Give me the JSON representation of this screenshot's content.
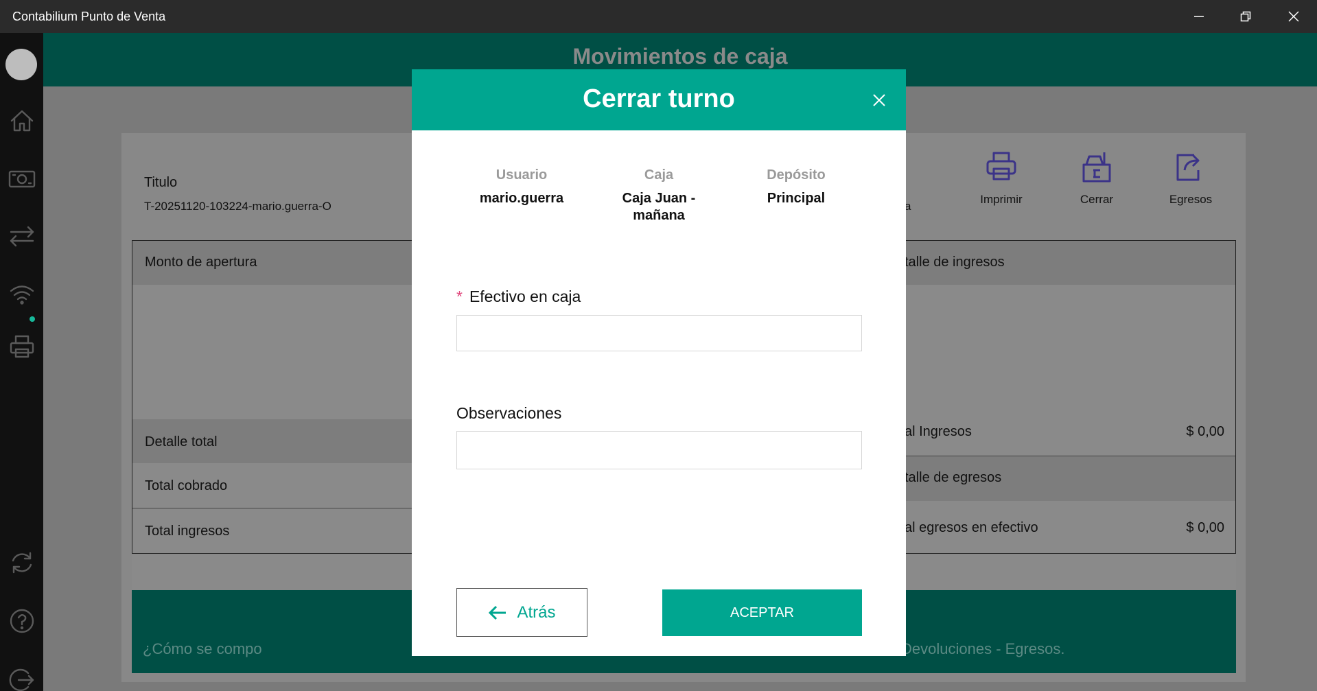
{
  "window": {
    "title": "Contabilium Punto de Venta"
  },
  "page": {
    "title": "Movimientos de caja"
  },
  "shift": {
    "title_label": "Titulo",
    "title_value": "T-20251120-103224-mario.guerra-O"
  },
  "toolbar": {
    "partial_label": "a",
    "print_label": "Imprimir",
    "close_label": "Cerrar",
    "expenses_label": "Egresos"
  },
  "left_panel": {
    "opening_amount": "Monto de apertura",
    "detail_total": "Detalle total",
    "total_collected": "Total cobrado",
    "total_income": "Total ingresos"
  },
  "right_panel": {
    "income_detail": "talle de ingresos",
    "income_total_label": "al Ingresos",
    "income_total_value": "$ 0,00",
    "expense_detail": "talle de egresos",
    "cash_expense_label": "al egresos en efectivo",
    "cash_expense_value": "$ 0,00"
  },
  "banner": {
    "left_text": "¿Cómo se compo",
    "right_text": "Devoluciones - Egresos."
  },
  "modal": {
    "title": "Cerrar turno",
    "user_label": "Usuario",
    "user_value": "mario.guerra",
    "register_label": "Caja",
    "register_value_line1": "Caja Juan -",
    "register_value_line2": "mañana",
    "deposit_label": "Depósito",
    "deposit_value": "Principal",
    "required_mark": "*",
    "cash_label": "Efectivo en caja",
    "cash_value": "",
    "notes_label": "Observaciones",
    "notes_value": "",
    "back_label": "Atrás",
    "accept_label": "ACEPTAR"
  }
}
